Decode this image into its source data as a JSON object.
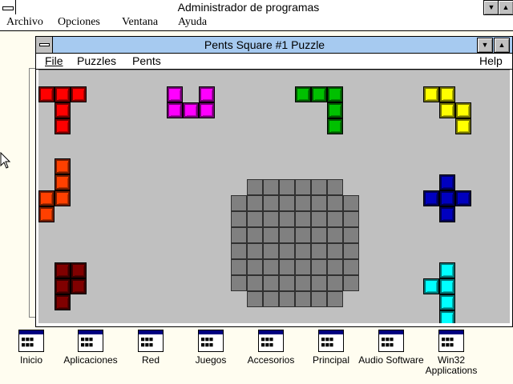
{
  "program_manager": {
    "title": "Administrador de programas",
    "menu": [
      "Archivo",
      "Opciones",
      "Ventana",
      "Ayuda"
    ],
    "minimize_glyph": "▼",
    "maximize_glyph": "▲"
  },
  "pents_window": {
    "title": "Pents Square #1 Puzzle",
    "menu": [
      "File",
      "Puzzles",
      "Pents"
    ],
    "help": "Help",
    "minimize_glyph": "▼",
    "maximize_glyph": "▲"
  },
  "pieces": [
    {
      "name": "red",
      "color": "#ff0000",
      "cells": [
        [
          0,
          0
        ],
        [
          1,
          0
        ],
        [
          2,
          0
        ],
        [
          1,
          1
        ],
        [
          1,
          2
        ]
      ]
    },
    {
      "name": "magenta",
      "color": "#ff00ff",
      "cells": [
        [
          0,
          0
        ],
        [
          2,
          0
        ],
        [
          0,
          1
        ],
        [
          1,
          1
        ],
        [
          2,
          1
        ]
      ]
    },
    {
      "name": "green",
      "color": "#00c000",
      "cells": [
        [
          0,
          0
        ],
        [
          1,
          0
        ],
        [
          2,
          0
        ],
        [
          2,
          1
        ],
        [
          2,
          2
        ]
      ]
    },
    {
      "name": "yellow",
      "color": "#ffff00",
      "cells": [
        [
          0,
          0
        ],
        [
          1,
          0
        ],
        [
          1,
          1
        ],
        [
          2,
          1
        ],
        [
          2,
          2
        ]
      ]
    },
    {
      "name": "orange",
      "color": "#ff4000",
      "cells": [
        [
          1,
          0
        ],
        [
          1,
          1
        ],
        [
          1,
          2
        ],
        [
          0,
          2
        ],
        [
          0,
          3
        ]
      ]
    },
    {
      "name": "blue",
      "color": "#0000c0",
      "cells": [
        [
          1,
          0
        ],
        [
          0,
          1
        ],
        [
          1,
          1
        ],
        [
          2,
          1
        ],
        [
          1,
          2
        ]
      ]
    },
    {
      "name": "brown",
      "color": "#800000",
      "cells": [
        [
          0,
          0
        ],
        [
          1,
          0
        ],
        [
          0,
          1
        ],
        [
          1,
          1
        ],
        [
          0,
          2
        ]
      ]
    },
    {
      "name": "cyan",
      "color": "#00ffff",
      "cells": [
        [
          1,
          0
        ],
        [
          0,
          1
        ],
        [
          1,
          1
        ],
        [
          1,
          2
        ],
        [
          1,
          3
        ]
      ]
    }
  ],
  "board": {
    "columns": 8,
    "rows": 8,
    "corner_cut": true,
    "color": "#808080"
  },
  "program_groups": [
    {
      "label": "Inicio",
      "icon": "program-group-icon"
    },
    {
      "label": "Aplicaciones",
      "icon": "program-group-icon"
    },
    {
      "label": "Red",
      "icon": "program-group-icon"
    },
    {
      "label": "Juegos",
      "icon": "program-group-icon"
    },
    {
      "label": "Accesorios",
      "icon": "program-group-icon"
    },
    {
      "label": "Principal",
      "icon": "program-group-icon"
    },
    {
      "label": "Audio Software",
      "icon": "program-group-icon"
    },
    {
      "label": "Win32 Applications",
      "icon": "program-group-icon"
    }
  ]
}
